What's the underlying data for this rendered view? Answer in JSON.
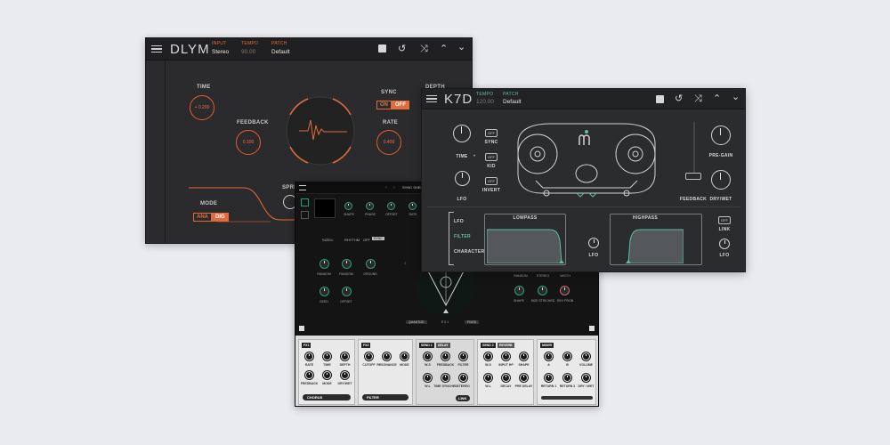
{
  "dlym": {
    "logo": "DLYM",
    "input_label": "INPUT",
    "input_value": "Stereo",
    "tempo_label": "TEMPO",
    "tempo_value": "90.00",
    "patch_label": "PATCH",
    "patch_value": "Default",
    "time_label": "TIME",
    "time_value": "+ 0.200",
    "feedback_label": "FEEDBACK",
    "feedback_value": "0.100",
    "sync_label": "SYNC",
    "sync_on": "ON",
    "sync_off": "OFF",
    "rate_label": "RATE",
    "rate_value": "0.400",
    "depth_label": "DEPTH",
    "mode_label": "MODE",
    "mode_ana": "ANA",
    "mode_dig": "DIG",
    "spread_label": "SPRE",
    "accent": "#e36a3a"
  },
  "synth": {
    "title": "SYNC SHEET E",
    "osc_labels": [
      "SHAPE",
      "PHASE",
      "OFFSET",
      "RATE"
    ],
    "size_label": "SIZE",
    "size_value": "16",
    "rhythm_label": "RHYTHM",
    "rhythm_off": "OFF",
    "rhythm_sync": "SYNC",
    "left_knob_labels": [
      "RANDOM",
      "RANDOM",
      "GROUND",
      "SEED",
      "OFFSET"
    ],
    "right_knob_labels": [
      "RANDOM",
      "STEREO",
      "WIDTH",
      "SHAPE",
      "SIZE STRICHED",
      "REV PROB"
    ],
    "quantize_label": "QUANTIZE",
    "freq_value": "E 0.1",
    "fixed_label": "FIXED",
    "fx1": {
      "title": "FX1",
      "knobs": [
        "RATE",
        "TIME",
        "DEPTH",
        "FEEDBACK",
        "MODE",
        "DRY/WET"
      ],
      "pill": "CHORUS"
    },
    "fx2": {
      "title": "FX2",
      "knobs": [
        "CUTOFF",
        "RESONANCE",
        "MODE"
      ],
      "pill": "FILTER"
    },
    "send1": {
      "title": "SEND 1",
      "tag": "DELAY",
      "knobs": [
        "W-S",
        "FEEDBACK",
        "FILTER",
        "W-L",
        "TIME SYNCHED",
        "STEREO"
      ],
      "pill": "LINK"
    },
    "send2": {
      "title": "SEND 2",
      "tag": "REVERB",
      "knobs": [
        "W-S",
        "INPUT HP",
        "SHAPE",
        "W-L",
        "DECAY",
        "PRE DELAY"
      ]
    },
    "mixer": {
      "title": "MIXER",
      "knobs": [
        "A",
        "B",
        "VOLUME",
        "RETURN 1",
        "RETURN 2",
        "DRY / WET"
      ]
    },
    "accent": "#2e9c7e"
  },
  "k7d": {
    "logo": "K7D",
    "tempo_label": "TEMPO",
    "tempo_value": "120.00",
    "patch_label": "PATCH",
    "patch_value": "Default",
    "time_label": "TIME",
    "lfo_label": "LFO",
    "sync_btn": "OFF",
    "sync_label": "SYNC",
    "kid_btn": "OFF",
    "kid_label": "KID",
    "invert_btn": "OFF",
    "invert_label": "INVERT",
    "feedback_label": "FEEDBACK",
    "pregain_label": "PRE-GAIN",
    "drywet_label": "DRY/WET",
    "tabs": [
      "LFO",
      "FILTER",
      "CHARACTER"
    ],
    "active_tab": "FILTER",
    "lowpass_label": "LOWPASS",
    "highpass_label": "HIGHPASS",
    "lfo2_label": "LFO",
    "link_btn": "OFF",
    "link_label": "LINK",
    "lfo3_label": "LFO",
    "accent": "#5fbf9d"
  }
}
